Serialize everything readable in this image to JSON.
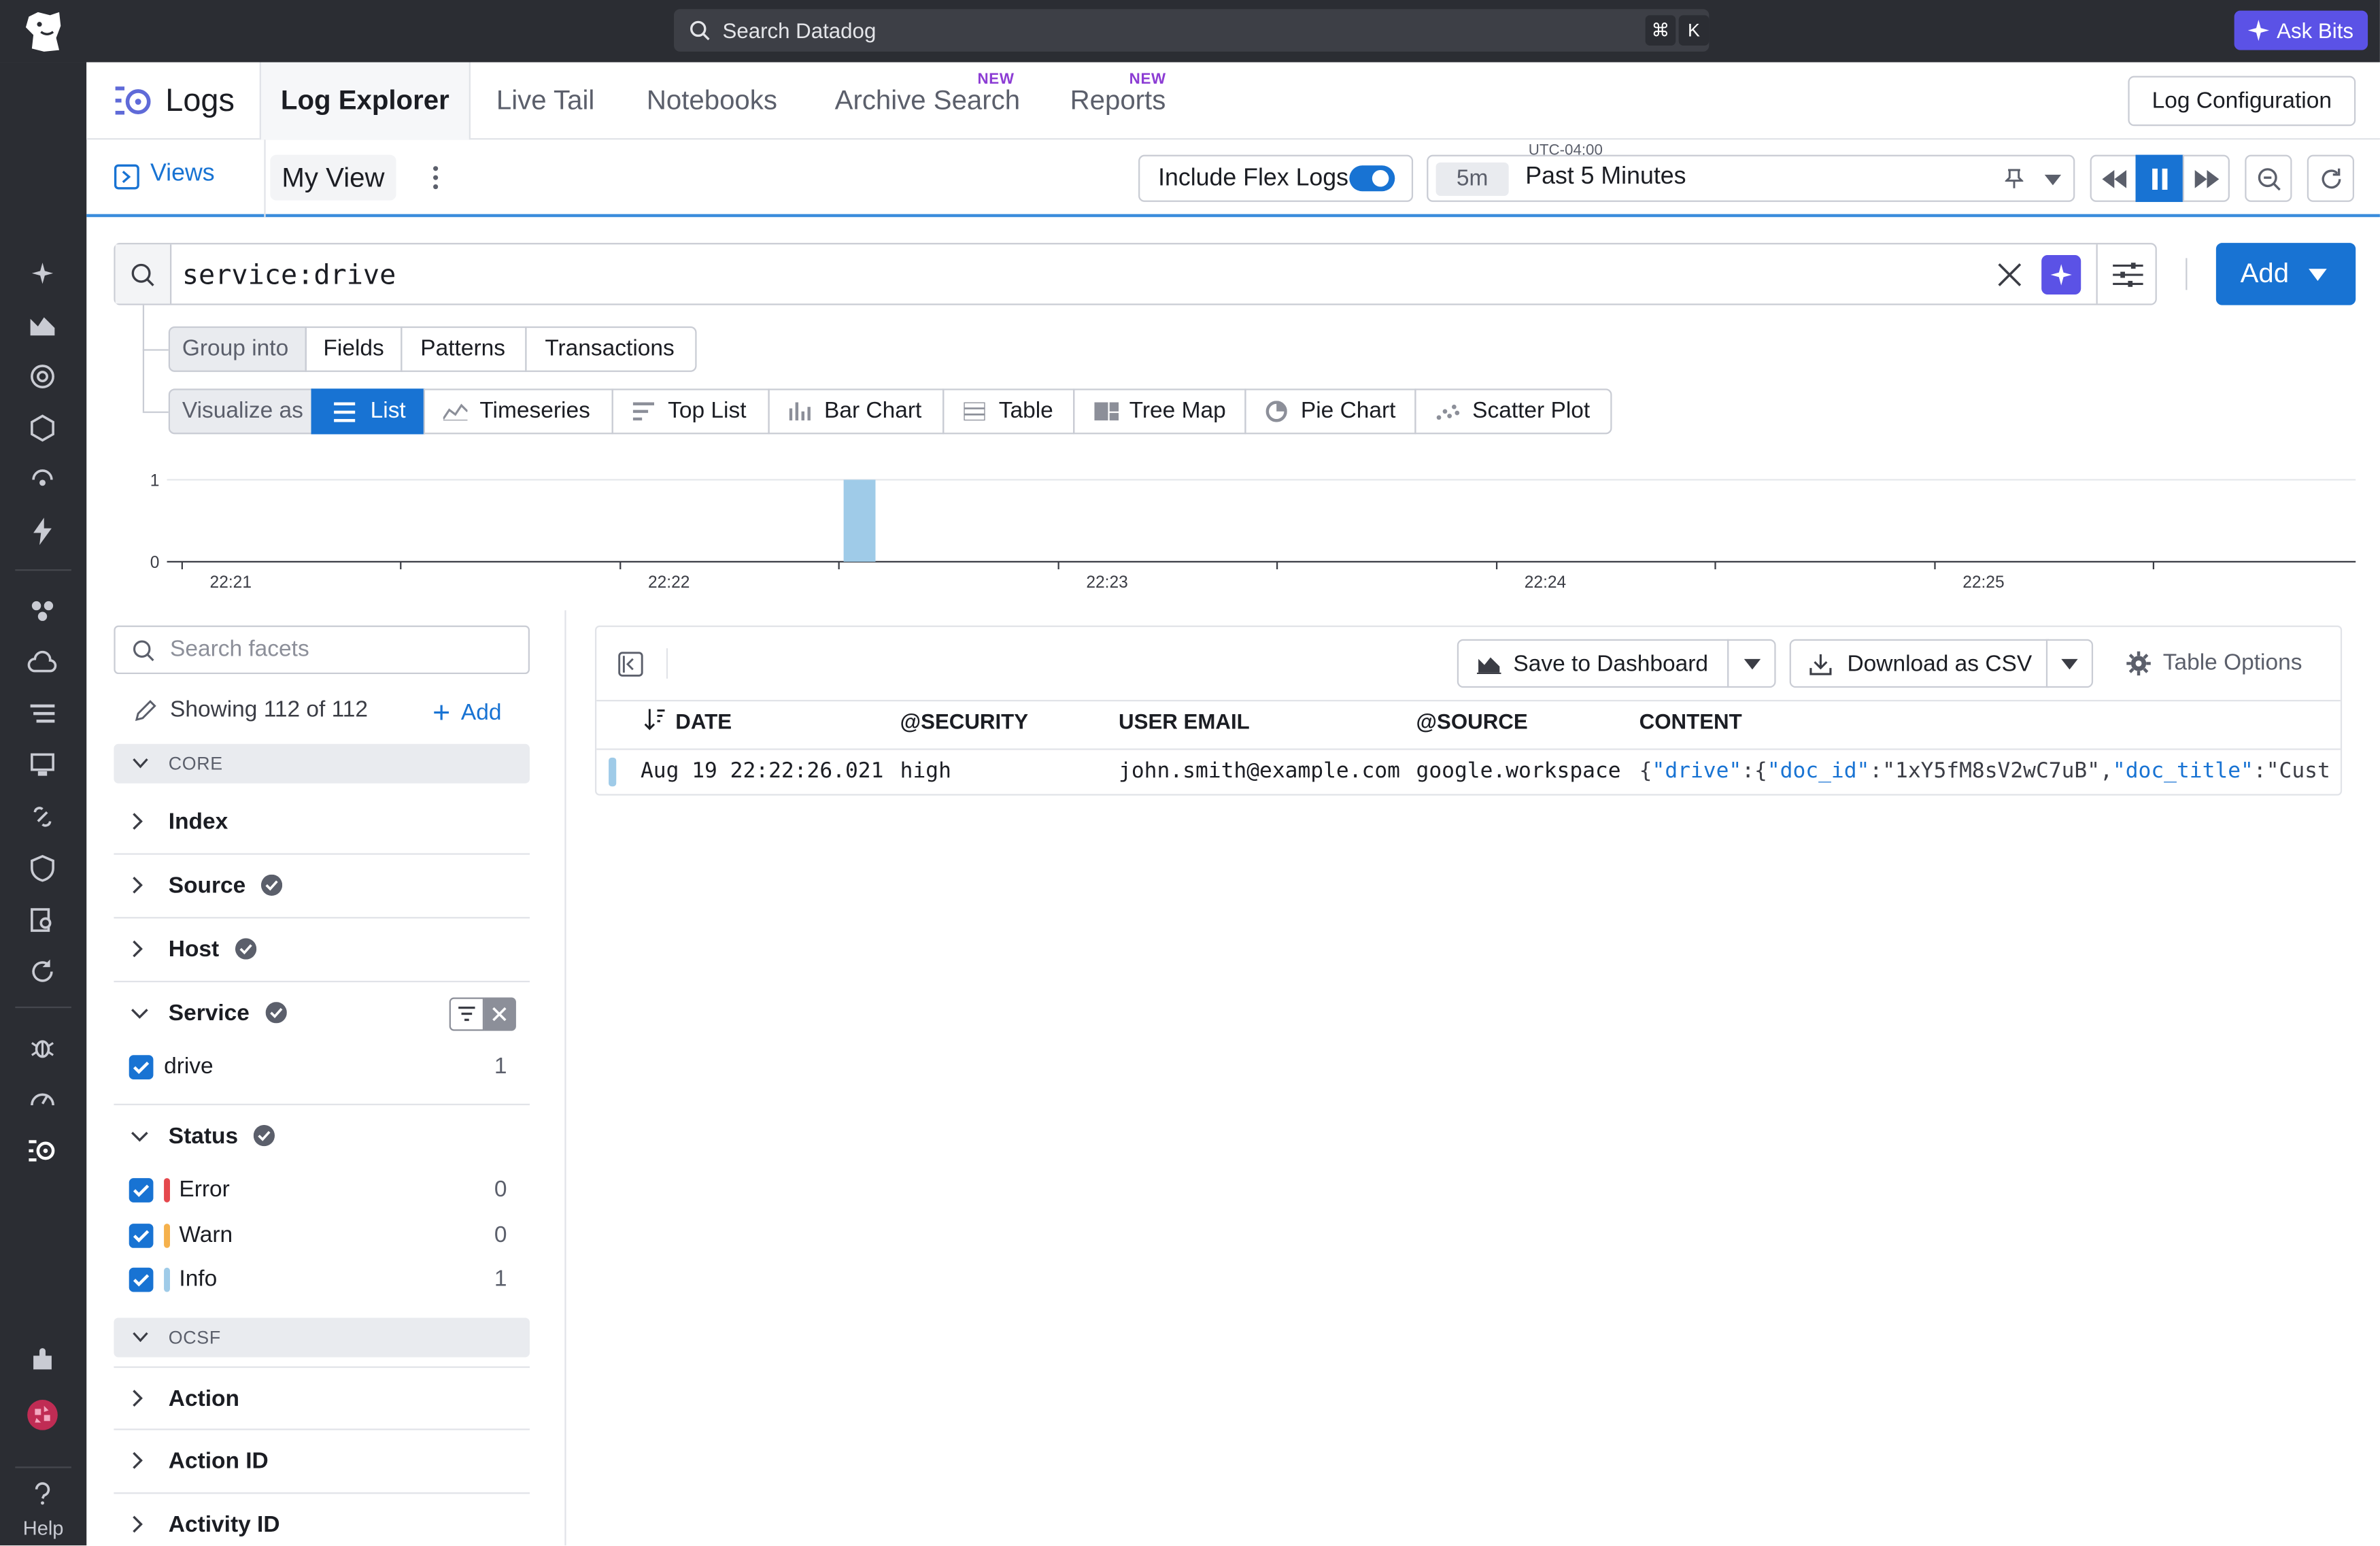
{
  "topbar": {
    "search_placeholder": "Search Datadog",
    "shortcut_cmd": "⌘",
    "shortcut_key": "K",
    "ask_bits": "Ask Bits"
  },
  "sidebar": {
    "help": "Help"
  },
  "header": {
    "product": "Logs",
    "tabs": [
      "Log Explorer",
      "Live Tail",
      "Notebooks",
      "Archive Search",
      "Reports"
    ],
    "new_badge": "NEW",
    "log_config": "Log Configuration"
  },
  "subbar": {
    "views": "Views",
    "my_view": "My View",
    "flex_logs": "Include Flex Logs",
    "timezone": "UTC-04:00",
    "time_short": "5m",
    "time_range": "Past 5 Minutes"
  },
  "query": {
    "value": "service:drive",
    "add": "Add"
  },
  "group": {
    "label": "Group into",
    "options": [
      "Fields",
      "Patterns",
      "Transactions"
    ]
  },
  "visualize": {
    "label": "Visualize as",
    "options": [
      "List",
      "Timeseries",
      "Top List",
      "Bar Chart",
      "Table",
      "Tree Map",
      "Pie Chart",
      "Scatter Plot"
    ]
  },
  "chart_data": {
    "type": "bar",
    "x": [
      "22:22:26"
    ],
    "values": [
      1
    ],
    "ylim": [
      0,
      1
    ],
    "yticks": [
      "1",
      "0"
    ],
    "xticks": [
      "22:21",
      "22:22",
      "22:23",
      "22:24",
      "22:25"
    ],
    "bar_color": "#9fcbe8"
  },
  "facets": {
    "search_placeholder": "Search facets",
    "showing": "Showing 112 of 112",
    "add": "Add",
    "core": "CORE",
    "ocsf": "OCSF",
    "index": "Index",
    "source": "Source",
    "host": "Host",
    "service": "Service",
    "service_values": [
      {
        "name": "drive",
        "count": "1"
      }
    ],
    "status": "Status",
    "status_values": [
      {
        "name": "Error",
        "count": "0",
        "color": "#e5484d"
      },
      {
        "name": "Warn",
        "count": "0",
        "color": "#f5b14c"
      },
      {
        "name": "Info",
        "count": "1",
        "color": "#9fcbe8"
      }
    ],
    "action": "Action",
    "action_id": "Action ID",
    "activity_id": "Activity ID"
  },
  "results": {
    "save_dashboard": "Save to Dashboard",
    "download_csv": "Download as CSV",
    "table_options": "Table Options",
    "columns": [
      "DATE",
      "@SECURITY",
      "USER EMAIL",
      "@SOURCE",
      "CONTENT"
    ],
    "rows": [
      {
        "date": "Aug 19 22:22:26.021",
        "security": "high",
        "email": "john.smith@example.com",
        "source": "google.workspace",
        "content_k1": "\"drive\"",
        "content_k2": "\"doc_id\"",
        "content_v2": "\"1xY5fM8sV2wC7uB\"",
        "content_k3": "\"doc_title\"",
        "content_v3": "\"Cust…"
      }
    ]
  }
}
